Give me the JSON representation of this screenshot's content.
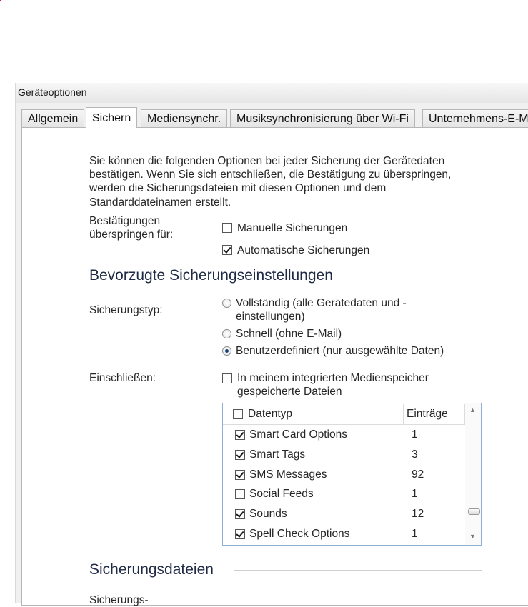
{
  "window": {
    "title": "Geräteoptionen"
  },
  "tabs": [
    {
      "label": "Allgemein",
      "active": false
    },
    {
      "label": "Sichern",
      "active": true
    },
    {
      "label": "Mediensynchr.",
      "active": false
    },
    {
      "label": "Musiksynchronisierung über Wi-Fi",
      "active": false
    },
    {
      "label": "Unternehmens-E-M",
      "active": false
    }
  ],
  "backup": {
    "description": "Sie können die folgenden Optionen bei jeder Sicherung der Gerätedaten bestätigen. Wenn Sie sich entschließen, die Bestätigung zu überspringen, werden die Sicherungsdateien mit diesen Optionen und dem Standarddateinamen erstellt.",
    "skip_label": "Bestätigungen überspringen für:",
    "skip_options": [
      {
        "label": "Manuelle Sicherungen",
        "checked": false
      },
      {
        "label": "Automatische Sicherungen",
        "checked": true
      }
    ],
    "preferred_heading": "Bevorzugte Sicherungseinstellungen",
    "type_label": "Sicherungstyp:",
    "type_options": [
      {
        "label": "Vollständig (alle Gerätedaten und -einstellungen)",
        "selected": false
      },
      {
        "label": "Schnell (ohne E-Mail)",
        "selected": false
      },
      {
        "label": "Benutzerdefiniert (nur ausgewählte Daten)",
        "selected": true
      }
    ],
    "include_label": "Einschließen:",
    "include_media": {
      "label": "In meinem integrierten Medienspeicher gespeicherte Dateien",
      "checked": false
    },
    "datatype_list": {
      "columns": [
        "Datentyp",
        "Einträge"
      ],
      "header_checked": false,
      "rows": [
        {
          "name": "Smart Card Options",
          "entries": "1",
          "checked": true
        },
        {
          "name": "Smart Tags",
          "entries": "3",
          "checked": true
        },
        {
          "name": "SMS Messages",
          "entries": "92",
          "checked": true
        },
        {
          "name": "Social Feeds",
          "entries": "1",
          "checked": false
        },
        {
          "name": "Sounds",
          "entries": "12",
          "checked": true
        },
        {
          "name": "Spell Check Options",
          "entries": "1",
          "checked": true
        }
      ]
    },
    "files_heading": "Sicherungsdateien",
    "files_label_partial": "Sicherungs-"
  },
  "colors": {
    "section_heading": "#1f2a44",
    "list_border": "#8faed0",
    "window_bg": "#f0f0f0"
  }
}
